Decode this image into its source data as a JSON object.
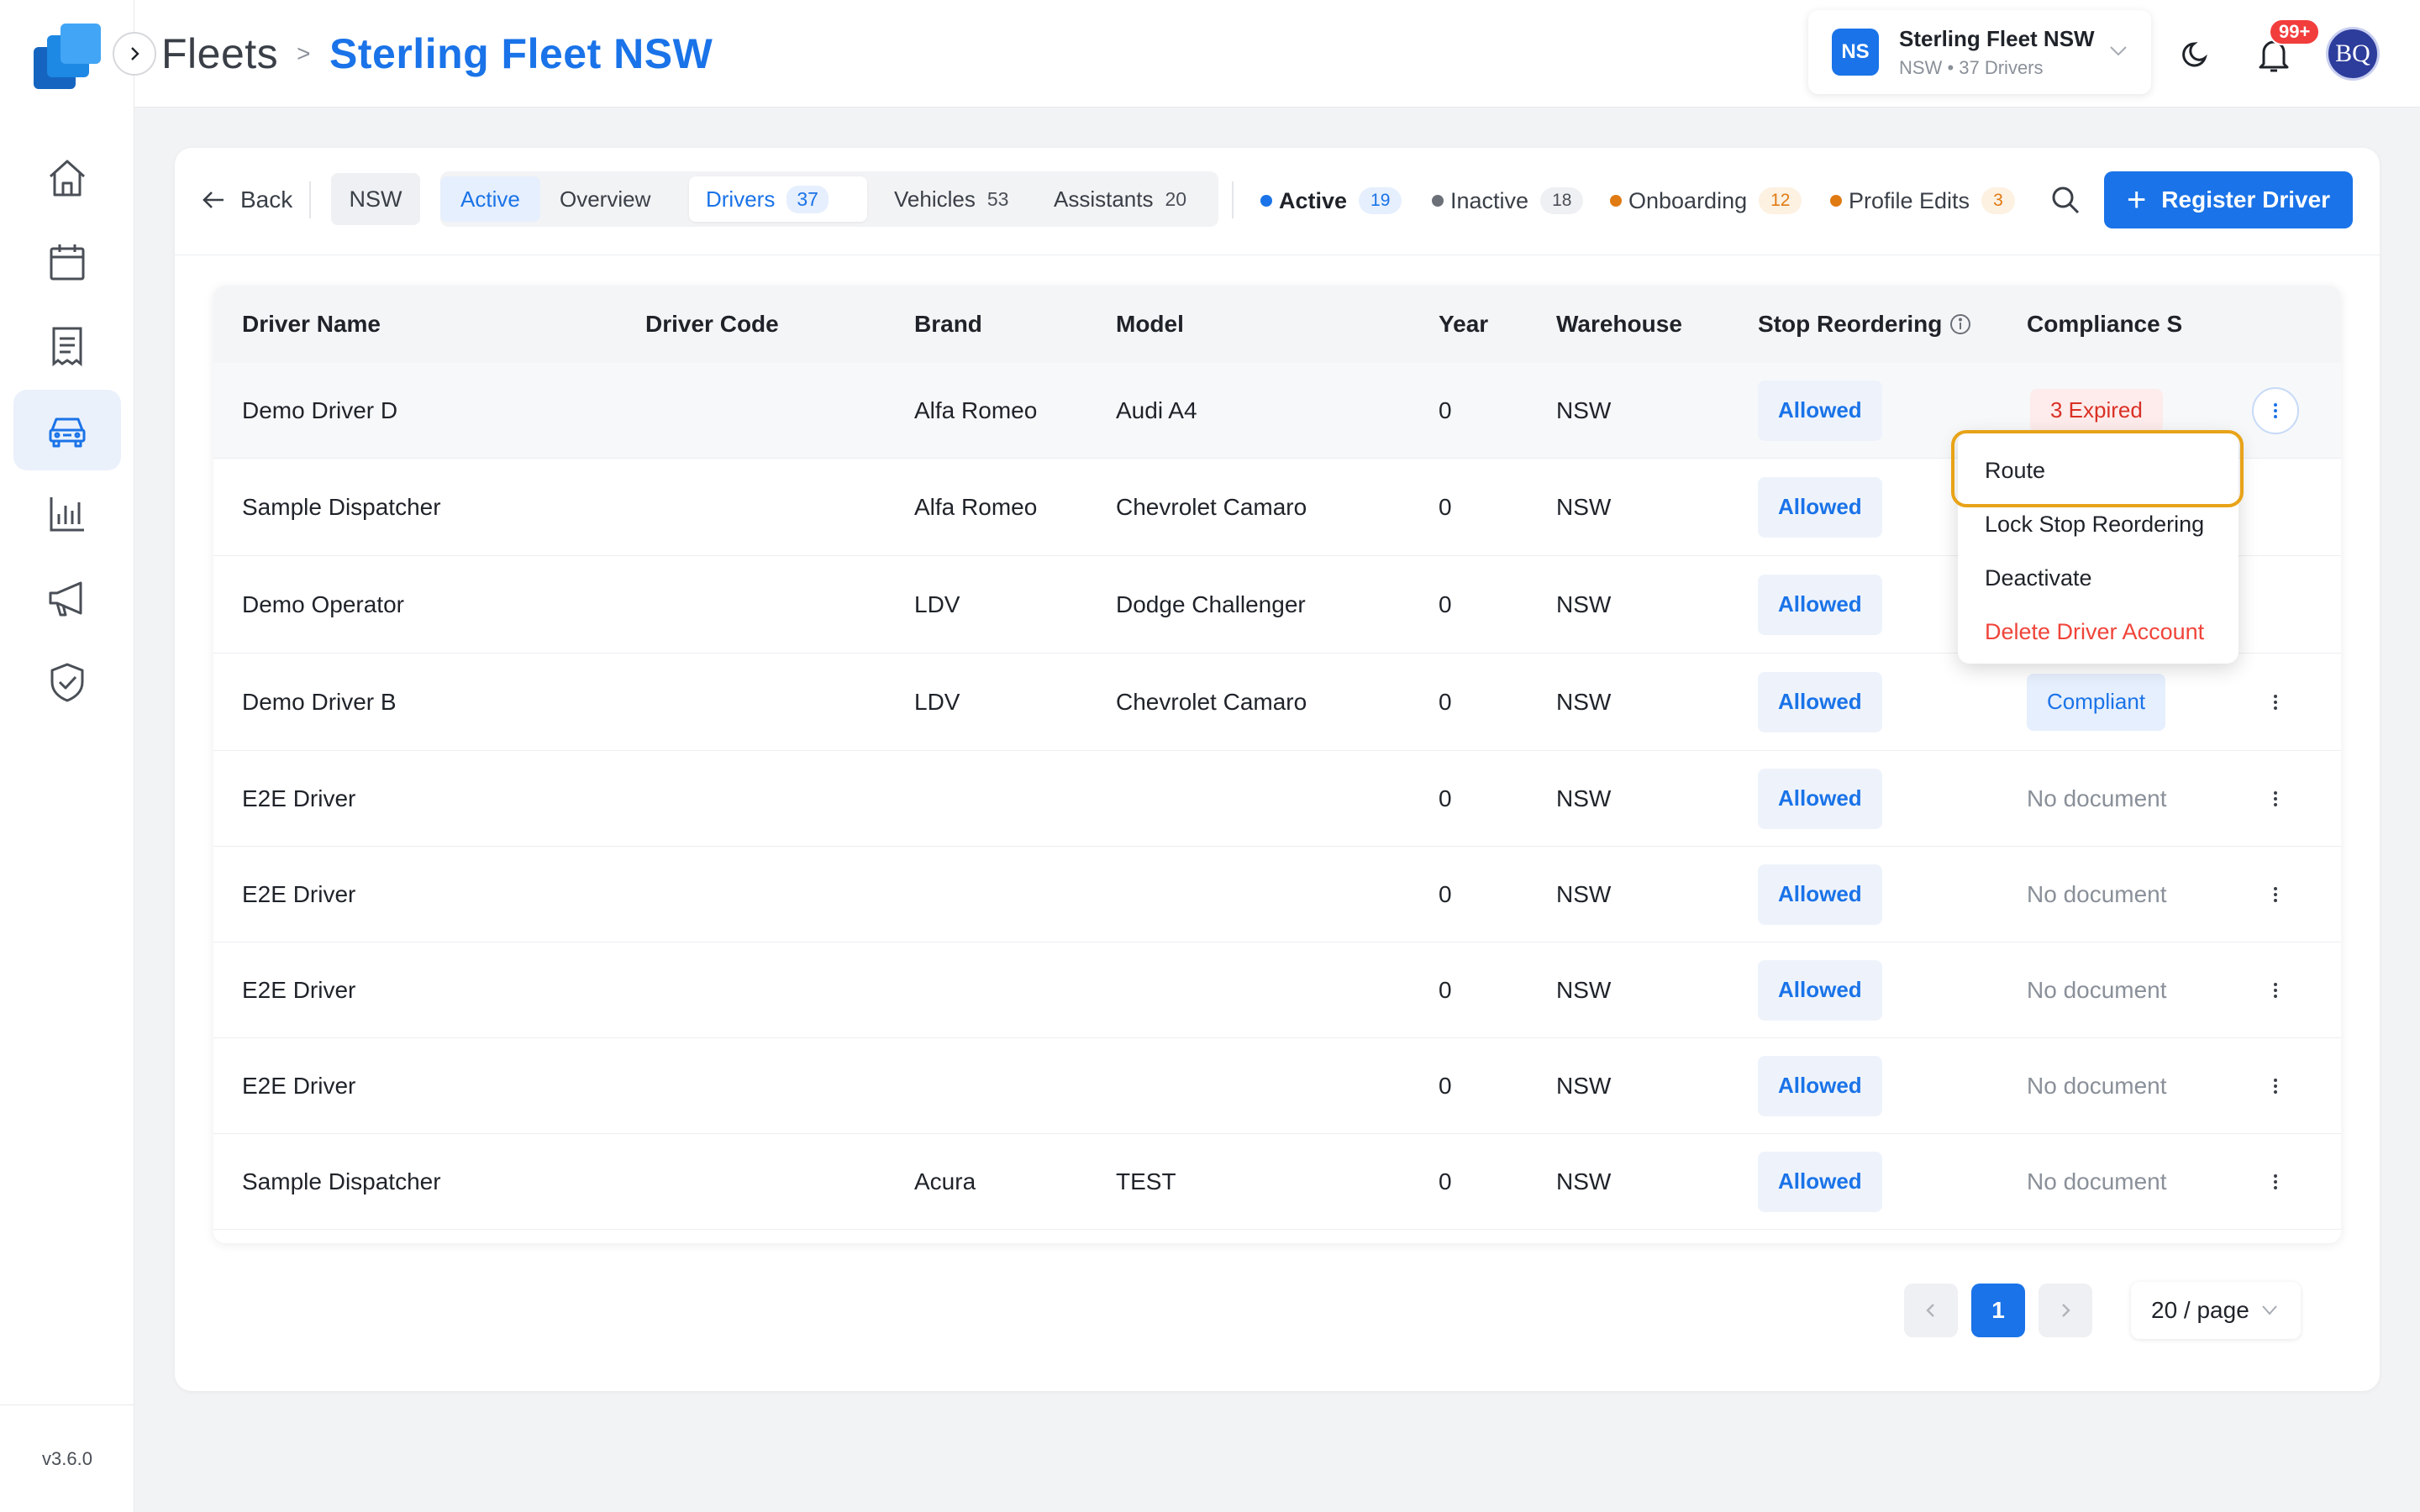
{
  "app": {
    "version": "v3.6.0"
  },
  "breadcrumb": {
    "root": "Fleets",
    "separator": ">",
    "current": "Sterling Fleet NSW"
  },
  "fleet_switcher": {
    "initials": "NS",
    "name": "Sterling Fleet NSW",
    "subtitle": "NSW • 37 Drivers"
  },
  "notifications": {
    "badge": "99+"
  },
  "user": {
    "initials": "BQ"
  },
  "sidebar": {
    "items": [
      {
        "name": "home",
        "icon": "home-icon"
      },
      {
        "name": "calendar",
        "icon": "calendar-icon"
      },
      {
        "name": "orders",
        "icon": "document-list-icon"
      },
      {
        "name": "fleets",
        "icon": "car-icon",
        "active": true
      },
      {
        "name": "analytics",
        "icon": "bar-chart-icon"
      },
      {
        "name": "announcements",
        "icon": "megaphone-icon"
      },
      {
        "name": "compliance",
        "icon": "shield-check-icon"
      }
    ]
  },
  "toolbar": {
    "back_label": "Back",
    "region": "NSW",
    "tabs": [
      {
        "label": "Active",
        "count": ""
      },
      {
        "label": "Overview",
        "count": ""
      },
      {
        "label": "Drivers",
        "count": "37"
      },
      {
        "label": "Vehicles",
        "count": "53"
      },
      {
        "label": "Assistants",
        "count": "20"
      }
    ],
    "status_filters": [
      {
        "label": "Active",
        "count": "19",
        "color": "#1a73e8"
      },
      {
        "label": "Inactive",
        "count": "18",
        "color": "#6b7078"
      },
      {
        "label": "Onboarding",
        "count": "12",
        "color": "#e07a12"
      },
      {
        "label": "Profile Edits",
        "count": "3",
        "color": "#e07a12"
      }
    ],
    "register_label": "Register Driver"
  },
  "table": {
    "columns": [
      "Driver Name",
      "Driver Code",
      "Brand",
      "Model",
      "Year",
      "Warehouse",
      "Stop Reordering",
      "Compliance S"
    ],
    "rows": [
      {
        "name": "Demo Driver D",
        "code": "",
        "brand": "Alfa Romeo",
        "model": "Audi A4",
        "year": "0",
        "warehouse": "NSW",
        "stop": "Allowed",
        "compliance": "3 Expired",
        "compliance_type": "expired"
      },
      {
        "name": "Sample Dispatcher",
        "code": "",
        "brand": "Alfa Romeo",
        "model": "Chevrolet Camaro",
        "year": "0",
        "warehouse": "NSW",
        "stop": "Allowed",
        "compliance": "",
        "compliance_type": "hidden"
      },
      {
        "name": "Demo Operator",
        "code": "",
        "brand": "LDV",
        "model": "Dodge Challenger",
        "year": "0",
        "warehouse": "NSW",
        "stop": "Allowed",
        "compliance": "",
        "compliance_type": "hidden"
      },
      {
        "name": "Demo Driver B",
        "code": "",
        "brand": "LDV",
        "model": "Chevrolet Camaro",
        "year": "0",
        "warehouse": "NSW",
        "stop": "Allowed",
        "compliance": "Compliant",
        "compliance_type": "compliant"
      },
      {
        "name": "E2E Driver",
        "code": "",
        "brand": "",
        "model": "",
        "year": "0",
        "warehouse": "NSW",
        "stop": "Allowed",
        "compliance": "No document",
        "compliance_type": "nodoc"
      },
      {
        "name": "E2E Driver",
        "code": "",
        "brand": "",
        "model": "",
        "year": "0",
        "warehouse": "NSW",
        "stop": "Allowed",
        "compliance": "No document",
        "compliance_type": "nodoc"
      },
      {
        "name": "E2E Driver",
        "code": "",
        "brand": "",
        "model": "",
        "year": "0",
        "warehouse": "NSW",
        "stop": "Allowed",
        "compliance": "No document",
        "compliance_type": "nodoc"
      },
      {
        "name": "E2E Driver",
        "code": "",
        "brand": "",
        "model": "",
        "year": "0",
        "warehouse": "NSW",
        "stop": "Allowed",
        "compliance": "No document",
        "compliance_type": "nodoc"
      },
      {
        "name": "Sample Dispatcher",
        "code": "",
        "brand": "Acura",
        "model": "TEST",
        "year": "0",
        "warehouse": "NSW",
        "stop": "Allowed",
        "compliance": "No document",
        "compliance_type": "nodoc"
      }
    ]
  },
  "row_menu": {
    "items": [
      {
        "label": "Route",
        "danger": false
      },
      {
        "label": "Lock Stop Reordering",
        "danger": false
      },
      {
        "label": "Deactivate",
        "danger": false
      },
      {
        "label": "Delete Driver Account",
        "danger": true
      }
    ]
  },
  "pagination": {
    "current_page": "1",
    "page_size": "20 / page"
  }
}
